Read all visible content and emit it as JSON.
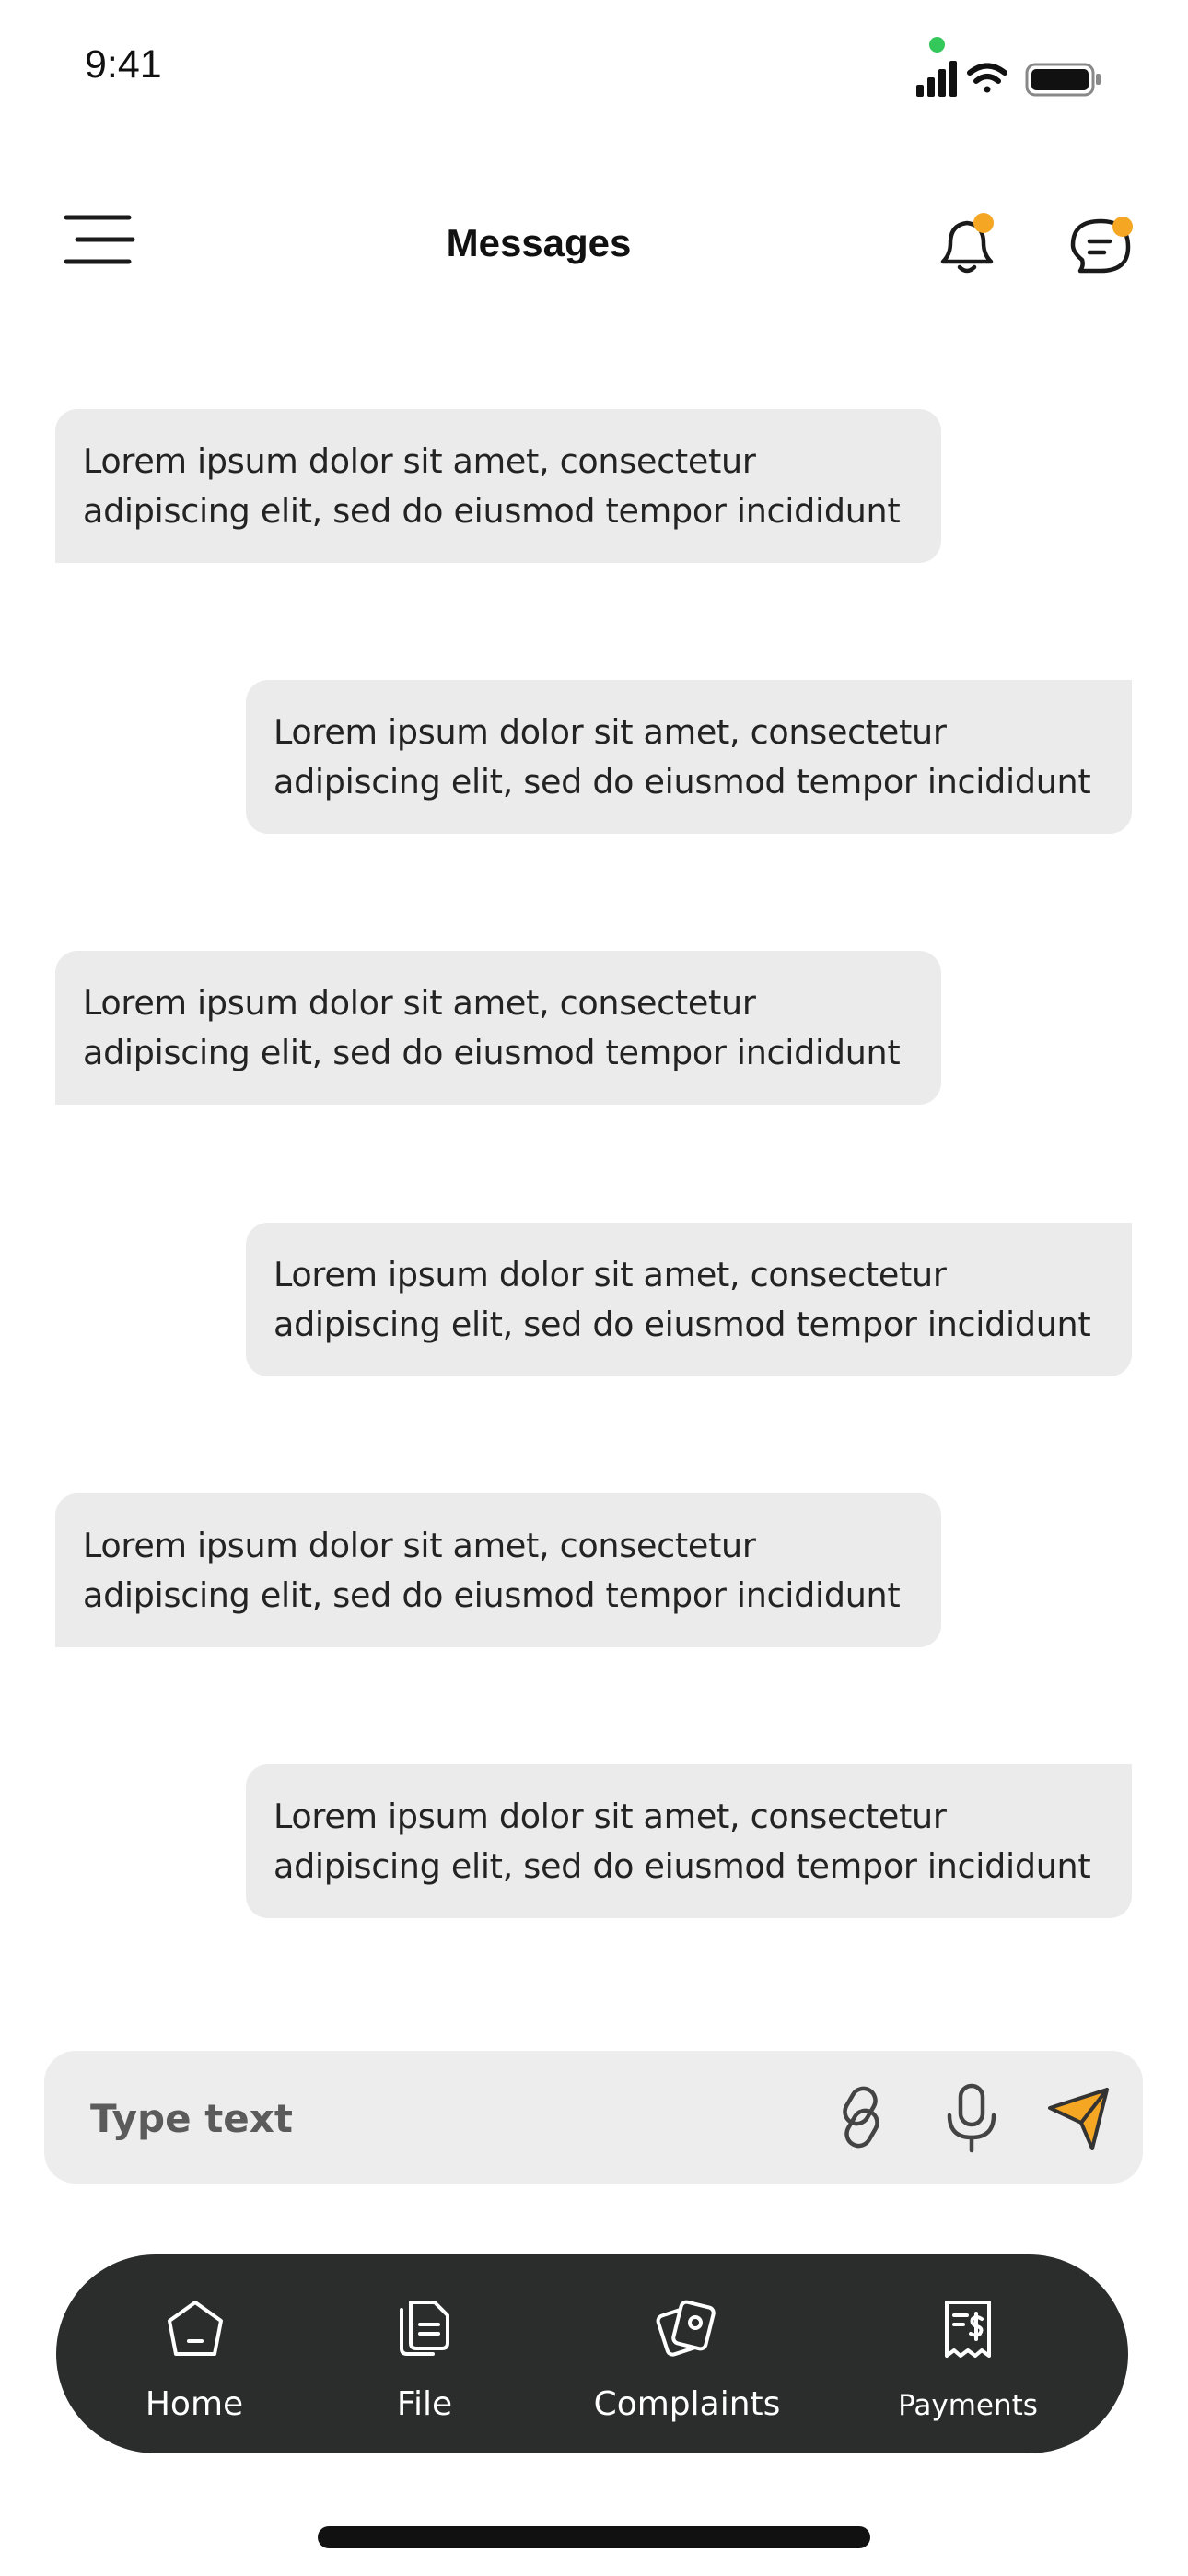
{
  "status_bar": {
    "time": "9:41"
  },
  "header": {
    "title": "Messages",
    "icons": [
      "menu-icon",
      "bell-icon",
      "chat-icon"
    ],
    "badge_color": "#f5a623"
  },
  "messages": [
    {
      "direction": "incoming",
      "line1": "Lorem ipsum dolor sit amet, consectetur",
      "line2": "adipiscing elit, sed do eiusmod tempor incididunt"
    },
    {
      "direction": "outgoing",
      "line1": "Lorem ipsum dolor sit amet, consectetur",
      "line2": "adipiscing elit, sed do eiusmod tempor incididunt"
    },
    {
      "direction": "incoming",
      "line1": "Lorem ipsum dolor sit amet, consectetur",
      "line2": "adipiscing elit, sed do eiusmod tempor incididunt"
    },
    {
      "direction": "outgoing",
      "line1": "Lorem ipsum dolor sit amet, consectetur",
      "line2": "adipiscing elit, sed do eiusmod tempor incididunt"
    },
    {
      "direction": "incoming",
      "line1": "Lorem ipsum dolor sit amet, consectetur",
      "line2": "adipiscing elit, sed do eiusmod tempor incididunt"
    },
    {
      "direction": "outgoing",
      "line1": "Lorem ipsum dolor sit amet, consectetur",
      "line2": "adipiscing elit, sed do eiusmod tempor incididunt"
    }
  ],
  "composer": {
    "placeholder": "Type text",
    "icons": [
      "link-icon",
      "microphone-icon",
      "send-icon"
    ],
    "send_color": "#f5a623"
  },
  "bottom_nav": {
    "items": [
      {
        "label": "Home",
        "icon": "home-icon"
      },
      {
        "label": "File",
        "icon": "file-icon"
      },
      {
        "label": "Complaints",
        "icon": "complaints-icon"
      },
      {
        "label": "Payments",
        "icon": "payments-icon"
      }
    ],
    "background": "#2b2c2c"
  }
}
